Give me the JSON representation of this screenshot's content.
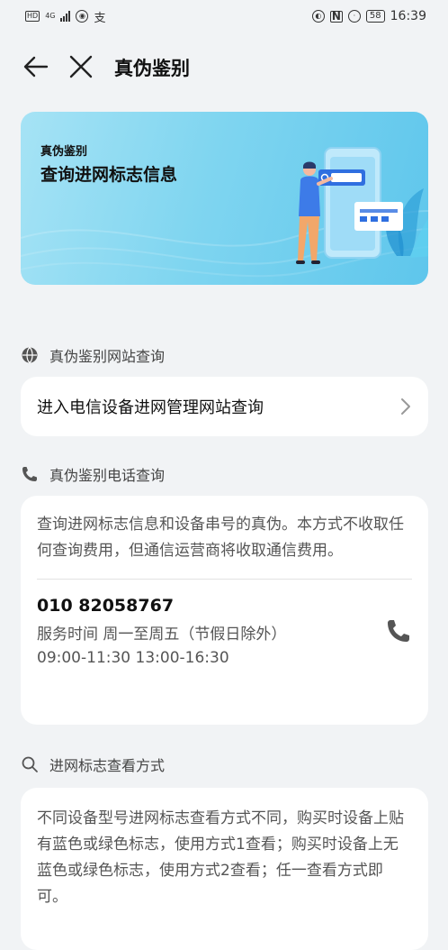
{
  "status_bar": {
    "hd": "HD",
    "net": "4G",
    "pay": "支",
    "battery": "58",
    "time": "16:39"
  },
  "header": {
    "title": "真伪鉴别"
  },
  "banner": {
    "kicker": "真伪鉴别",
    "heading": "查询进网标志信息"
  },
  "website_section": {
    "heading": "真伪鉴别网站查询",
    "icon": "globe-icon",
    "link_label": "进入电信设备进网管理网站查询"
  },
  "phone_section": {
    "heading": "真伪鉴别电话查询",
    "icon": "phone-icon",
    "description": "查询进网标志信息和设备串号的真伪。本方式不收取任何查询费用，但通信运营商将收取通信费用。",
    "phone_number": "010 82058767",
    "service_hours": "服务时间 周一至周五（节假日除外）",
    "service_times": "09:00-11:30 13:00-16:30"
  },
  "method_section": {
    "heading": "进网标志查看方式",
    "icon": "search-icon",
    "description": "不同设备型号进网标志查看方式不同，购买时设备上贴有蓝色或绿色标志，使用方式1查看；购买时设备上无蓝色或绿色标志，使用方式2查看；任一查看方式即可。"
  },
  "colors": {
    "background": "#f1f3f5",
    "card": "#ffffff",
    "banner_start": "#a6e3f5",
    "banner_end": "#5ec6ec",
    "accent_blue": "#2f6fe0"
  }
}
